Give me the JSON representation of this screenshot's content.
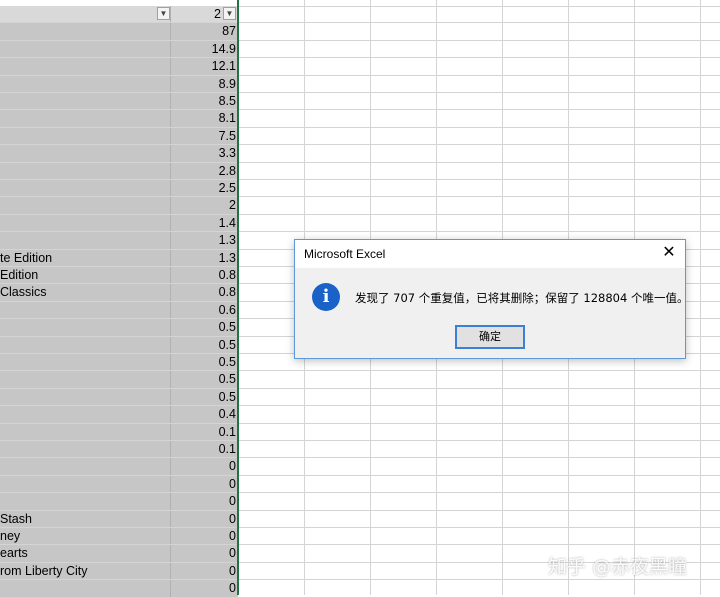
{
  "sheet": {
    "header": {
      "value_b": "2"
    },
    "rows": [
      {
        "a": "",
        "b": "87"
      },
      {
        "a": "",
        "b": "14.9"
      },
      {
        "a": "",
        "b": "12.1"
      },
      {
        "a": "",
        "b": "8.9"
      },
      {
        "a": "",
        "b": "8.5"
      },
      {
        "a": "",
        "b": "8.1"
      },
      {
        "a": "",
        "b": "7.5"
      },
      {
        "a": "",
        "b": "3.3"
      },
      {
        "a": "",
        "b": "2.8"
      },
      {
        "a": "",
        "b": "2.5"
      },
      {
        "a": "",
        "b": "2"
      },
      {
        "a": "",
        "b": "1.4"
      },
      {
        "a": "",
        "b": "1.3"
      },
      {
        "a": "te Edition",
        "b": "1.3"
      },
      {
        "a": " Edition",
        "b": "0.8"
      },
      {
        "a": "Classics",
        "b": "0.8"
      },
      {
        "a": "",
        "b": "0.6"
      },
      {
        "a": "",
        "b": "0.5"
      },
      {
        "a": "",
        "b": "0.5"
      },
      {
        "a": "",
        "b": "0.5"
      },
      {
        "a": "",
        "b": "0.5"
      },
      {
        "a": "",
        "b": "0.5"
      },
      {
        "a": "",
        "b": "0.4"
      },
      {
        "a": "",
        "b": "0.1"
      },
      {
        "a": "",
        "b": "0.1"
      },
      {
        "a": "",
        "b": "0"
      },
      {
        "a": "",
        "b": "0"
      },
      {
        "a": "",
        "b": "0"
      },
      {
        "a": "Stash",
        "b": "0"
      },
      {
        "a": "ney",
        "b": "0"
      },
      {
        "a": "earts",
        "b": "0"
      },
      {
        "a": "rom Liberty City",
        "b": "0"
      },
      {
        "a": "",
        "b": "0"
      }
    ]
  },
  "dialog": {
    "title": "Microsoft Excel",
    "close_glyph": "✕",
    "info_glyph": "i",
    "message": "发现了 707 个重复值，已将其删除；保留了 128804 个唯一值。",
    "ok_label": "确定"
  },
  "watermark": "知乎 @赤夜黑瞳",
  "colors": {
    "selection": "#217346",
    "info_icon": "#1a62c8",
    "dialog_border": "#5b9bd5"
  }
}
